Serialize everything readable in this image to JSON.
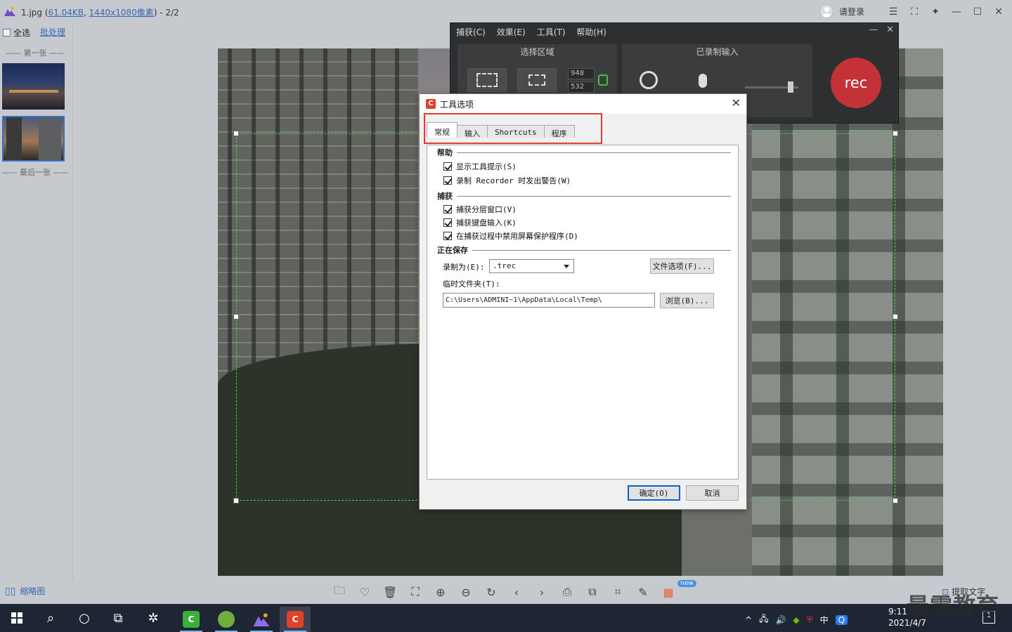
{
  "viewer": {
    "title_prefix": "1.jpg (",
    "file_size": "61.04KB",
    "title_sep": ", ",
    "resolution": "1440x1080像素",
    "title_suffix": ") - 2/2",
    "login": "请登录",
    "select_all": "全选",
    "batch": "批处理",
    "first": "—— 第一张 ——",
    "last": "—— 最后一张 ——",
    "thumbs_view": "缩略图",
    "new_badge": "new",
    "extract_text": "提取文字"
  },
  "recorder": {
    "menu": [
      "捕获(C)",
      "效果(E)",
      "工具(T)",
      "帮助(H)"
    ],
    "select_area": "选择区域",
    "recorded_inputs": "已录制输入",
    "width": "948",
    "height": "532",
    "rec": "rec"
  },
  "dialog": {
    "title": "工具选项",
    "tabs": [
      "常规",
      "输入",
      "Shortcuts",
      "程序"
    ],
    "group_help": "帮助",
    "show_tooltips": "显示工具提示(S)",
    "warn_recorder": "录制 Recorder 时发出警告(W)",
    "group_capture": "捕获",
    "capture_layered": "捕获分层窗口(V)",
    "capture_keyboard": "捕获键盘输入(K)",
    "disable_screensaver": "在捕获过程中禁用屏幕保护程序(D)",
    "group_saving": "正在保存",
    "record_as_label": "录制为(E):",
    "record_as_value": ".trec",
    "file_options": "文件选项(F)...",
    "temp_folder_label": "临时文件夹(T):",
    "temp_folder_value": "C:\\Users\\ADMINI~1\\AppData\\Local\\Temp\\",
    "browse": "浏览(B)...",
    "ok": "确定(O)",
    "cancel": "取消"
  },
  "taskbar": {
    "ime": "中",
    "time": "9:11",
    "date": "2021/4/7",
    "notif_count": "1"
  },
  "watermark": "最需教育",
  "colors": {
    "rec_red": "#c23236",
    "highlight_red": "#e53935",
    "selection_green": "#3ad13a",
    "link_blue": "#3a66b7"
  }
}
